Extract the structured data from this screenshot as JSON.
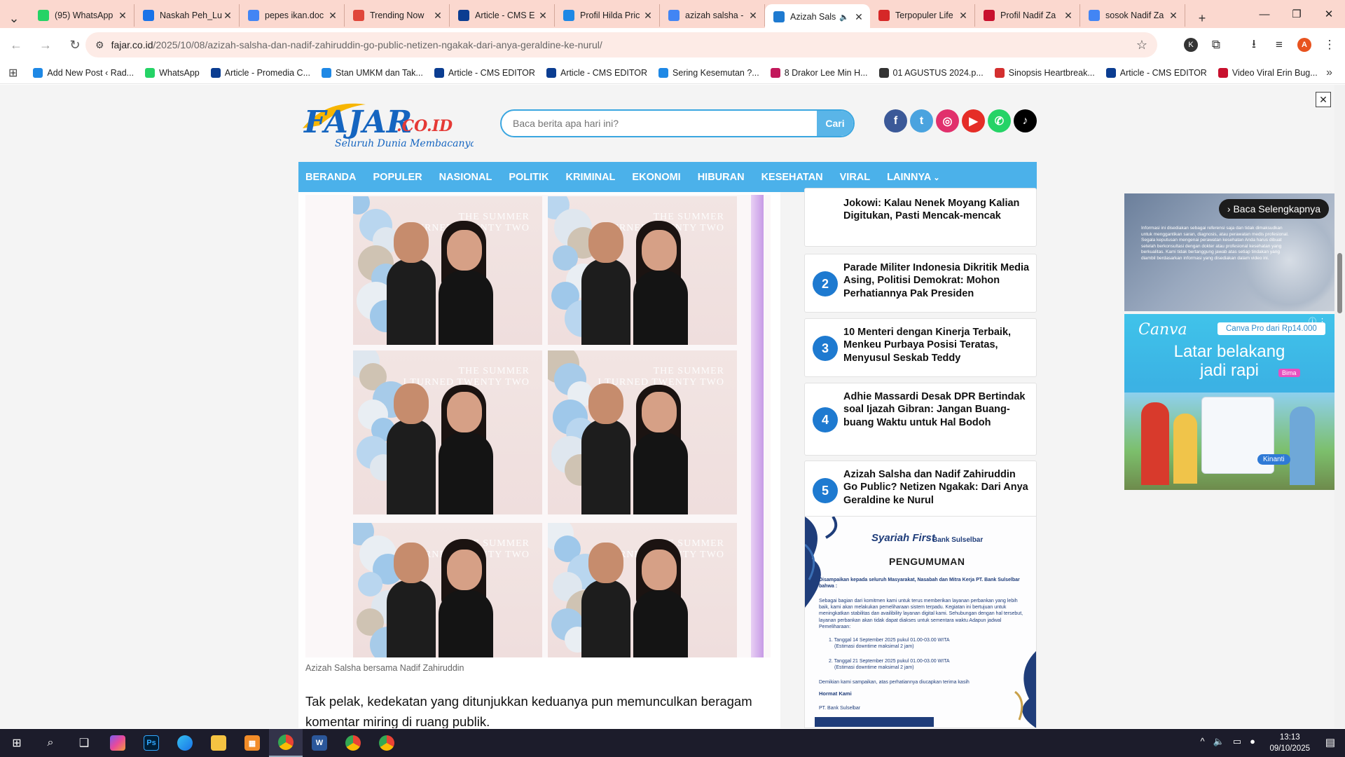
{
  "browser": {
    "tabs": [
      {
        "title": "(95) WhatsApp",
        "icon": "whatsapp-icon",
        "color": "#25d366"
      },
      {
        "title": "Naskah Peh_Lu",
        "icon": "drive-icon",
        "color": "#1a73e8"
      },
      {
        "title": "pepes ikan.doc",
        "icon": "docs-icon",
        "color": "#4285f4"
      },
      {
        "title": "Trending Now",
        "icon": "trending-icon",
        "color": "#e0463a"
      },
      {
        "title": "Article - CMS E",
        "icon": "cms-icon",
        "color": "#0b3d91"
      },
      {
        "title": "Profil Hilda Pric",
        "icon": "bookmark-icon",
        "color": "#1e88e5"
      },
      {
        "title": "azizah salsha -",
        "icon": "google-icon",
        "color": "#4285f4"
      },
      {
        "title": "Azizah Sals",
        "icon": "fajar-icon",
        "color": "#1e7ad0",
        "active": true
      },
      {
        "title": "Terpopuler Life",
        "icon": "site-icon",
        "color": "#d62828"
      },
      {
        "title": "Profil Nadif Za",
        "icon": "v-icon",
        "color": "#c8102e"
      },
      {
        "title": "sosok Nadif Za",
        "icon": "google-icon",
        "color": "#4285f4"
      }
    ],
    "url_host": "fajar.co.id",
    "url_path": "/2025/10/08/azizah-salsha-dan-nadif-zahiruddin-go-public-netizen-ngakak-dari-anya-geraldine-ke-nurul/",
    "profile_initial": "A",
    "ext_initial": "K",
    "bookmarks": [
      {
        "label": "Add New Post ‹ Rad...",
        "color": "#1e88e5"
      },
      {
        "label": "WhatsApp",
        "color": "#25d366"
      },
      {
        "label": "Article - Promedia C...",
        "color": "#0b3d91"
      },
      {
        "label": "Stan UMKM dan Tak...",
        "color": "#1e88e5"
      },
      {
        "label": "Article - CMS EDITOR",
        "color": "#0b3d91"
      },
      {
        "label": "Article - CMS EDITOR",
        "color": "#0b3d91"
      },
      {
        "label": "Sering Kesemutan ?...",
        "color": "#1e88e5"
      },
      {
        "label": "8 Drakor Lee Min H...",
        "color": "#c2185b"
      },
      {
        "label": "01 AGUSTUS 2024.p...",
        "color": "#333333"
      },
      {
        "label": "Sinopsis Heartbreak...",
        "color": "#d32f2f"
      },
      {
        "label": "Article - CMS EDITOR",
        "color": "#0b3d91"
      },
      {
        "label": "Video Viral Erin Bug...",
        "color": "#c8102e"
      }
    ]
  },
  "site": {
    "logo_text": "FAJAR",
    "logo_suffix": ".CO.ID",
    "tagline": "Seluruh Dunia Membacanya",
    "search_placeholder": "Baca berita apa hari ini?",
    "search_button": "Cari",
    "socials": [
      {
        "name": "facebook",
        "glyph": "f",
        "color": "#3b5998"
      },
      {
        "name": "twitter",
        "glyph": "t",
        "color": "#4aa3df"
      },
      {
        "name": "instagram",
        "glyph": "◎",
        "color": "#e1306c"
      },
      {
        "name": "youtube",
        "glyph": "▶",
        "color": "#e52d27"
      },
      {
        "name": "whatsapp",
        "glyph": "✆",
        "color": "#25d366"
      },
      {
        "name": "tiktok",
        "glyph": "♪",
        "color": "#000000"
      }
    ],
    "menu": [
      "BERANDA",
      "POPULER",
      "NASIONAL",
      "POLITIK",
      "KRIMINAL",
      "EKONOMI",
      "HIBURAN",
      "KESEHATAN",
      "VIRAL",
      "LAINNYA"
    ]
  },
  "article": {
    "photo_overlay_text": [
      "THE SUMMER",
      "I TURNED TWENTY TWO"
    ],
    "caption": "Azizah Salsha bersama Nadif Zahiruddin",
    "body_lines": [
      "Tak pelak, kedekatan yang ditunjukkan keduanya pun memunculkan beragam",
      "komentar miring di ruang publik."
    ]
  },
  "popular": [
    {
      "num": "",
      "title": "Jokowi: Kalau Nenek Moyang Kalian Digitukan, Pasti Mencak-mencak"
    },
    {
      "num": "2",
      "title": "Parade Militer Indonesia Dikritik Media Asing, Politisi Demokrat: Mohon Perhatiannya Pak Presiden"
    },
    {
      "num": "3",
      "title": "10 Menteri dengan Kinerja Terbaik, Menkeu Purbaya Posisi Teratas, Menyusul Seskab Teddy"
    },
    {
      "num": "4",
      "title": "Adhie Massardi Desak DPR Bertindak soal Ijazah Gibran: Jangan Buang-buang Waktu untuk Hal Bodoh"
    },
    {
      "num": "5",
      "title": "Azizah Salsha dan Nadif Zahiruddin Go Public? Netizen Ngakak: Dari Anya Geraldine ke Nurul"
    }
  ],
  "bank_ad": {
    "brand1": "Syariah First",
    "brand2": "Bank Sulselbar",
    "heading": "PENGUMUMAN",
    "intro": "Disampaikan kepada seluruh Masyarakat, Nasabah dan Mitra Kerja PT. Bank Sulselbar bahwa :",
    "para": "Sebagai bagian dari komitmen kami untuk terus memberikan layanan perbankan yang lebih baik, kami akan melakukan pemeliharaan sistem terpadu. Kegiatan ini bertujuan untuk meningkatkan stabilitas dan availibility layanan digital kami. Sehubungan dengan hal tersebut, layanan perbankan akan tidak dapat diakses untuk sementara waktu Adapun jadwal Pemeliharaan:",
    "item1": "1. Tanggal 14 September 2025 pukul 01.00-03.00 WITA",
    "item1b": "(Estimasi downtime maksimal 2 jam)",
    "item2": "2. Tanggal 21 September 2025 pukul 01.00-03.00 WITA",
    "item2b": "(Estimasi downtime maksimal 2 jam)",
    "closing": "Demikian kami sampaikan, atas perhatiannya diucapkan terima kasih",
    "sign": "Hormat Kami",
    "sign_org": "PT. Bank Sulselbar"
  },
  "ads": {
    "video_button": "Baca Selengkapnya",
    "video_disclaimer": "Informasi ini disediakan sebagai referensi saja dan tidak dimaksudkan untuk menggantikan saran, diagnosis, atau perawatan medis profesional. Segala keputusan mengenai perawatan kesehatan Anda harus dibuat setelah berkonsultasi dengan dokter atau profesional kesehatan yang berkualitas. Kami tidak bertanggung jawab atas setiap tindakan yang diambil berdasarkan informasi yang disediakan dalam video ini.",
    "canva_logo": "Canva",
    "canva_pill": "Canva Pro dari Rp14.000",
    "canva_headline1": "Latar belakang",
    "canva_headline2": "jadi rapi",
    "canva_tag": "Bima",
    "canva_tag2": "Kinanti"
  },
  "taskbar": {
    "time": "13:13",
    "date": "09/10/2025"
  }
}
